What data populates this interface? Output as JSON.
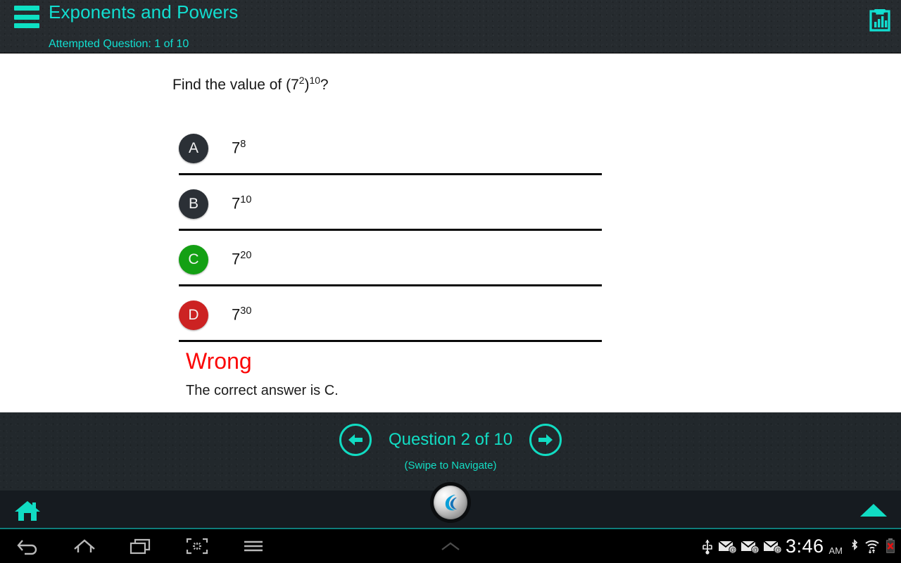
{
  "header": {
    "menu_icon": "hamburger-menu-icon",
    "title": "Exponents and Powers",
    "attempted": "Attempted Question: 1 of 10",
    "report_icon": "clipboard-chart-icon",
    "accent_color": "#12ded0",
    "background_color": "#262b2f"
  },
  "question": {
    "prompt_pre": "Find the value of (7",
    "prompt_sup1": "2",
    "prompt_mid": ")",
    "prompt_sup2": "10",
    "prompt_post": "?",
    "options": [
      {
        "letter": "A",
        "base": "7",
        "exp": "8",
        "state": "neutral",
        "color": "#2b3036"
      },
      {
        "letter": "B",
        "base": "7",
        "exp": "10",
        "state": "neutral",
        "color": "#2b3036"
      },
      {
        "letter": "C",
        "base": "7",
        "exp": "20",
        "state": "correct",
        "color": "#14a014"
      },
      {
        "letter": "D",
        "base": "7",
        "exp": "30",
        "state": "selected-wrong",
        "color": "#cc2222"
      }
    ],
    "verdict": "Wrong",
    "verdict_color": "#fb0505",
    "correct_note": "The correct answer is C."
  },
  "footer": {
    "prev_icon": "arrow-left-icon",
    "next_icon": "arrow-right-icon",
    "counter": "Question 2 of  10",
    "swipe_hint": "(Swipe to Navigate)",
    "accent_color": "#12ddc4"
  },
  "app_toolbar": {
    "home_icon": "home-icon",
    "logo_icon": "app-logo-icon",
    "collapse_icon": "triangle-up-icon",
    "accent_color": "#11dcc3"
  },
  "system_bar": {
    "nav_buttons": [
      "back-icon",
      "home-icon",
      "recents-icon",
      "screenshot-icon",
      "menu-icon"
    ],
    "chevron": "chevron-up-icon",
    "status_icons": [
      "usb-icon",
      "email-icon",
      "email-icon",
      "email-icon"
    ],
    "clock": "3:46",
    "ampm": "AM",
    "trailing_icons": [
      "bluetooth-icon",
      "wifi-icon",
      "battery-error-icon"
    ]
  }
}
